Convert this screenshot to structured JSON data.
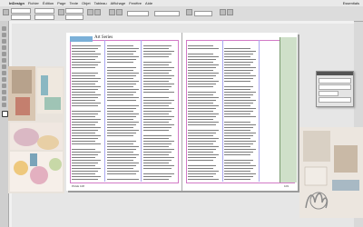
{
  "menubar": {
    "app_name": "InDesign",
    "items": [
      "Fichier",
      "Édition",
      "Page",
      "Texte",
      "Objet",
      "Tableau",
      "Affichage",
      "Fenêtre",
      "Aide"
    ],
    "right_text": "Essentials"
  },
  "page": {
    "header_label": "Art Series",
    "folio_left": "PAGE 108",
    "folio_right": "109"
  },
  "icons": {
    "pointer": "selection-tool-icon",
    "text": "type-tool-icon",
    "pen": "pen-tool-icon",
    "frame": "rectangle-frame-tool-icon"
  },
  "colors": {
    "accent": "#7bb0d8",
    "margin_guide": "#d27ac6",
    "column_guide": "#a8a6f0"
  }
}
